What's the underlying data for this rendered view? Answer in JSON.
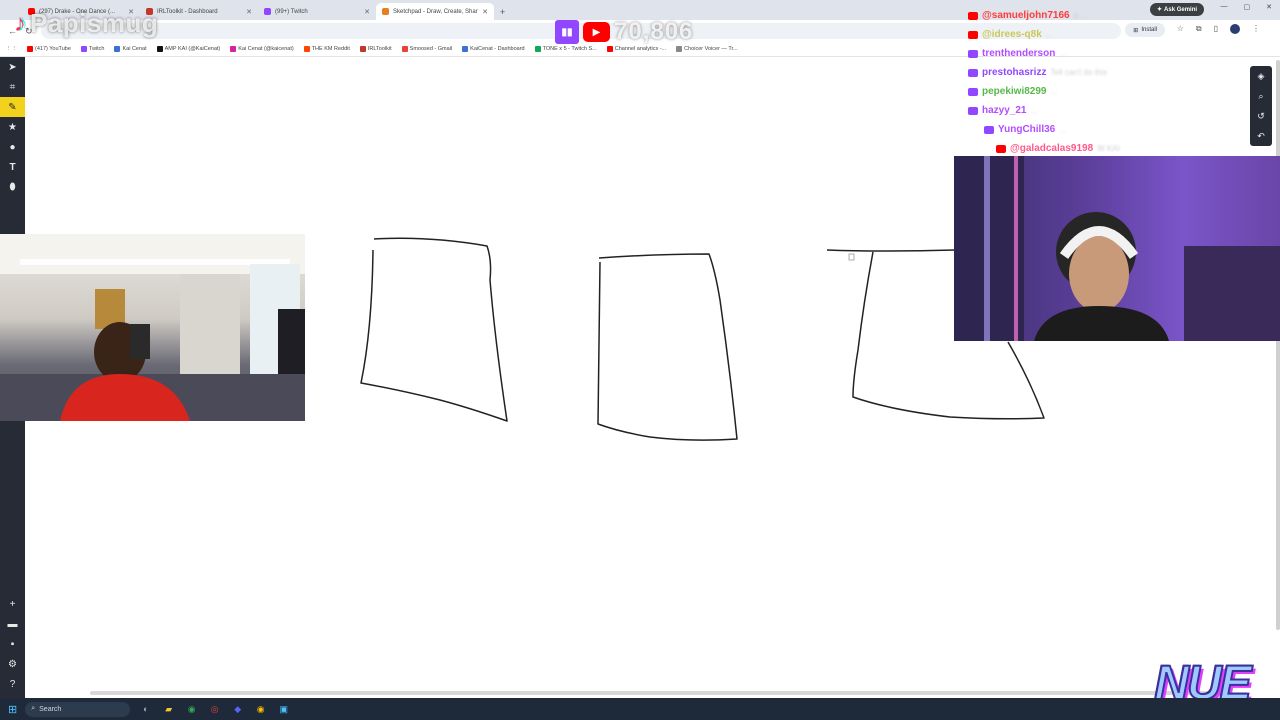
{
  "browser": {
    "tabs": [
      {
        "label": "(297) Drake - One Dance (...",
        "favicon_color": "#ff0000",
        "active": false
      },
      {
        "label": "IRLToolkit - Dashboard",
        "favicon_color": "#c0392b",
        "active": false
      },
      {
        "label": "(99+) Twitch",
        "favicon_color": "#9146ff",
        "active": false
      },
      {
        "label": "Sketchpad - Draw, Create, Shar",
        "favicon_color": "#e67e22",
        "active": true
      }
    ],
    "new_tab_glyph": "+",
    "install_label": "Install",
    "ask_gemini_label": "Ask Gemini",
    "bookmarks": [
      {
        "label": "(417) YouTube",
        "color": "#ff0000"
      },
      {
        "label": "Twitch",
        "color": "#9146ff"
      },
      {
        "label": "Kai Cenat",
        "color": "#3d6fd8"
      },
      {
        "label": "AMP KAI (@KaiCenat)",
        "color": "#111111"
      },
      {
        "label": "Kai Cenat (@kaicenat)",
        "color": "#d6249f"
      },
      {
        "label": "THE KM Reddit",
        "color": "#ff4500"
      },
      {
        "label": "IRLToolkit",
        "color": "#c0392b"
      },
      {
        "label": "Smoosed - Gmail",
        "color": "#ea4335"
      },
      {
        "label": "KaiCenat - Dashboard",
        "color": "#3d6fd8"
      },
      {
        "label": "TONE x 5 - Twitch S...",
        "color": "#0fa958"
      },
      {
        "label": "Channel analytics -...",
        "color": "#ff0000"
      },
      {
        "label": "Choicer Voicer — Tr...",
        "color": "#888888"
      }
    ]
  },
  "overlay": {
    "tiktok_name": "Papismug",
    "viewer_count": "70,806"
  },
  "chat": [
    {
      "user": "@samueljohn7166",
      "color": "#ff3b3b",
      "platform": "#ff0000",
      "msg": "a ..."
    },
    {
      "user": "@idrees-q8k",
      "color": "#c9c95a",
      "platform": "#ff0000",
      "msg": "..."
    },
    {
      "user": "trenthenderson",
      "color": "#b44cff",
      "platform": "#9146ff",
      "msg": "..."
    },
    {
      "user": "prestohasrizz",
      "color": "#9146ff",
      "platform": "#9146ff",
      "msg": "Tell can't do this"
    },
    {
      "user": "pepekiwi8299",
      "color": "#56b84a",
      "platform": "#9146ff",
      "msg": "..."
    },
    {
      "user": "hazyy_21",
      "color": "#b44cff",
      "platform": "#9146ff",
      "msg": "..."
    },
    {
      "user": "YungChill36",
      "color": "#b44cff",
      "platform": "#9146ff",
      "msg": "..."
    },
    {
      "user": "@galadcalas9198",
      "color": "#ff5a8a",
      "platform": "#ff0000",
      "msg": "W KAI"
    }
  ],
  "taskbar": {
    "search_label": "Search"
  },
  "branding": {
    "logo_text": "NUE"
  },
  "icons": {
    "tools": [
      "cursor-icon",
      "crop-icon",
      "pencil-icon",
      "star-icon",
      "circle-icon",
      "text-icon",
      "fill-icon"
    ],
    "bottom_tools": [
      "add-icon",
      "folder-icon",
      "save-icon",
      "share-icon",
      "help-icon"
    ]
  }
}
